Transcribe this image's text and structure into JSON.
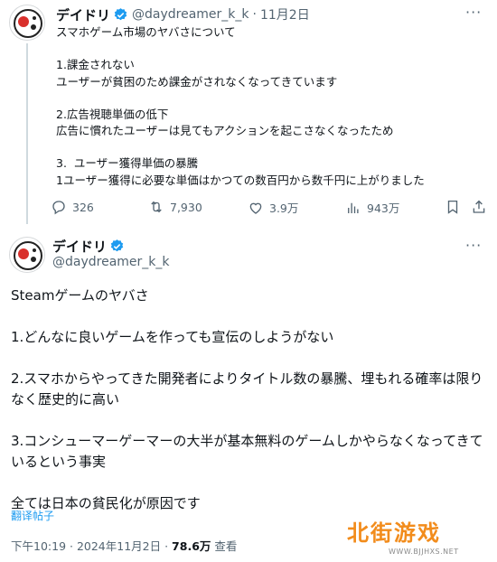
{
  "tweet1": {
    "name": "デイドリ",
    "handle": "@daydreamer_k_k",
    "date_sep": "·",
    "date": "11月2日",
    "more": "···",
    "lines": [
      "スマホゲーム市場のヤバさについて",
      "",
      "1.課金されない",
      "ユーザーが貧困のため課金がされなくなってきています",
      "",
      "2.広告視聴単価の低下",
      "広告に慣れたユーザーは見てもアクションを起こさなくなったため",
      "",
      "3.  ユーザー獲得単価の暴騰",
      "1ユーザー獲得に必要な単価はかつての数百円から数千円に上がりました"
    ],
    "stats": {
      "replies": "326",
      "retweets": "7,930",
      "likes": "3.9万",
      "views": "943万"
    }
  },
  "tweet2": {
    "name": "デイドリ",
    "handle": "@daydreamer_k_k",
    "more": "···",
    "lines": [
      "Steamゲームのヤバさ",
      "",
      "1.どんなに良いゲームを作っても宣伝のしようがない",
      "",
      "2.スマホからやってきた開発者によりタイトル数の暴騰、埋もれる確率は限りなく歴史的に高い",
      "",
      "3.コンシューマーゲーマーの大半が基本無料のゲームしかやらなくなってきているという事実",
      "",
      "全ては日本の貧民化が原因です"
    ],
    "translate": "翻译帖子",
    "time": "下午10:19 · 2024年11月2日 · ",
    "views": "78.6万",
    "views_label": " 查看"
  },
  "watermark": {
    "text": "北街游戏",
    "url": "WWW.BJJHXS.NET"
  },
  "colors": {
    "accent": "#1d9bf0",
    "muted": "#536471",
    "watermark": "#f28c1c"
  }
}
